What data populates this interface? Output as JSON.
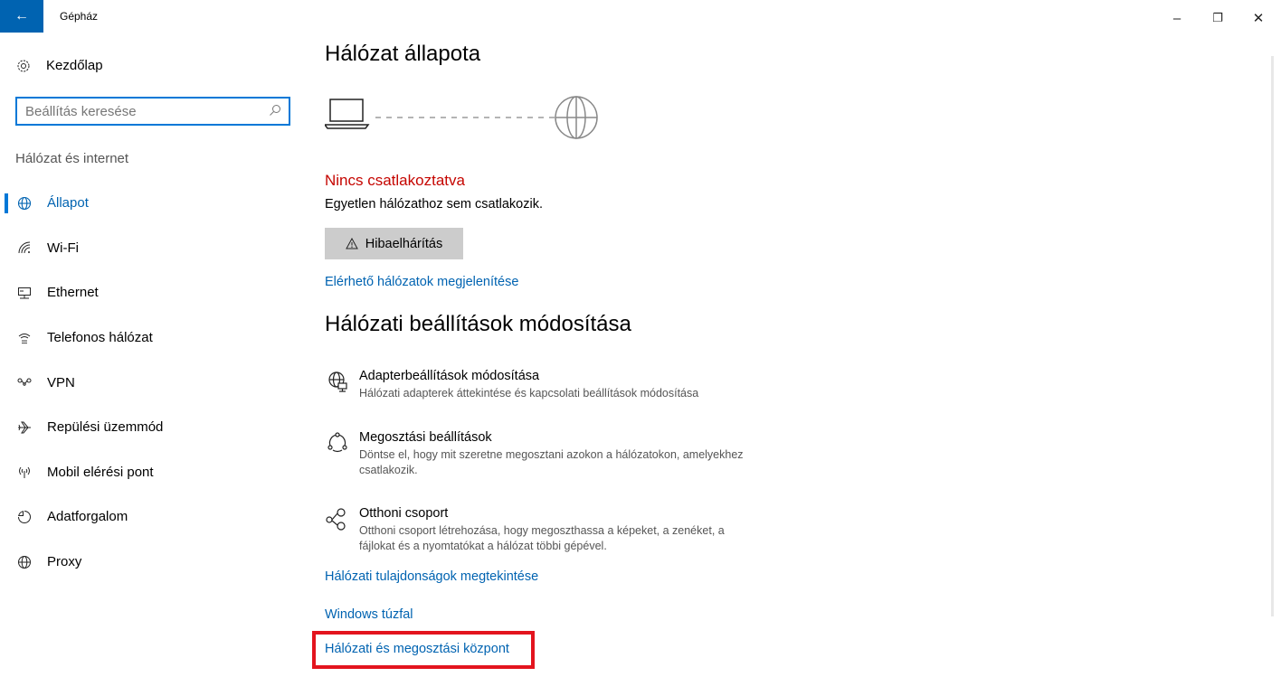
{
  "titlebar": {
    "back_glyph": "←",
    "app_title": "Gépház",
    "minimize_glyph": "–",
    "maximize_glyph": "❐",
    "close_glyph": "✕"
  },
  "sidebar": {
    "home_label": "Kezdőlap",
    "search_placeholder": "Beállítás keresése",
    "section_label": "Hálózat és internet",
    "items": [
      {
        "label": "Állapot",
        "icon": "globe-status-icon",
        "active": true
      },
      {
        "label": "Wi-Fi",
        "icon": "wifi-icon"
      },
      {
        "label": "Ethernet",
        "icon": "ethernet-icon"
      },
      {
        "label": "Telefonos hálózat",
        "icon": "dialup-icon"
      },
      {
        "label": "VPN",
        "icon": "vpn-icon"
      },
      {
        "label": "Repülési üzemmód",
        "icon": "airplane-icon"
      },
      {
        "label": "Mobil elérési pont",
        "icon": "hotspot-icon"
      },
      {
        "label": "Adatforgalom",
        "icon": "data-usage-icon"
      },
      {
        "label": "Proxy",
        "icon": "globe-icon"
      }
    ]
  },
  "main": {
    "title": "Hálózat állapota",
    "status_title": "Nincs csatlakoztatva",
    "status_desc": "Egyetlen hálózathoz sem csatlakozik.",
    "troubleshoot_label": "Hibaelhárítás",
    "show_networks_link": "Elérhető hálózatok megjelenítése",
    "change_title": "Hálózati beállítások módosítása",
    "options": [
      {
        "title": "Adapterbeállítások módosítása",
        "desc": "Hálózati adapterek áttekintése és kapcsolati beállítások módosítása",
        "icon": "adapter-icon"
      },
      {
        "title": "Megosztási beállítások",
        "desc": "Döntse el, hogy mit szeretne megosztani azokon a hálózatokon, amelyekhez csatlakozik.",
        "icon": "sharing-icon"
      },
      {
        "title": "Otthoni csoport",
        "desc": "Otthoni csoport létrehozása, hogy megoszthassa a képeket, a zenéket, a fájlokat és a nyomtatókat a hálózat többi gépével.",
        "icon": "homegroup-icon"
      }
    ],
    "links": {
      "properties": "Hálózati tulajdonságok megtekintése",
      "firewall": "Windows túzfal",
      "sharing_center": "Hálózati és megosztási központ"
    }
  },
  "colors": {
    "accent": "#0078d7",
    "link": "#0063b1",
    "error": "#c50500",
    "highlight": "#e3141e"
  }
}
